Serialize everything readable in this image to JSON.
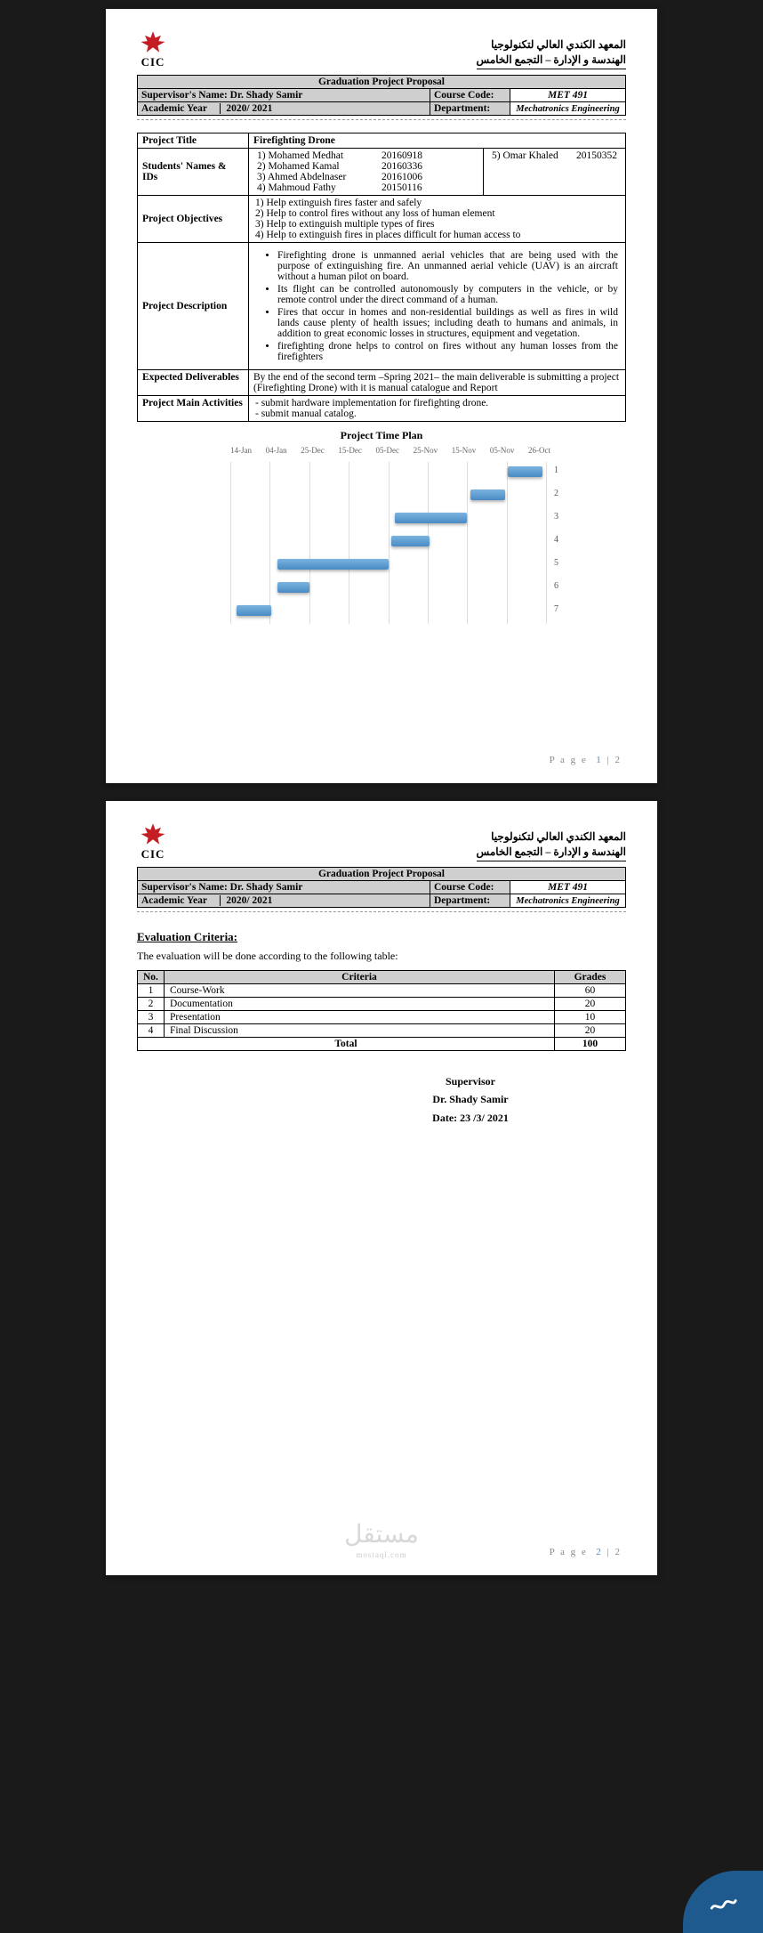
{
  "institute_name_ar_line1": "المعهد الكندي العالي لتكنولوجيا",
  "institute_name_ar_line2": "الهندسة و الإدارة – التجمع الخامس",
  "logo_text": "CIC",
  "proposal_title": "Graduation Project Proposal",
  "supervisor_label": "Supervisor's Name:",
  "supervisor_name": "Dr. Shady Samir",
  "course_code_label": "Course Code:",
  "course_code": "MET 491",
  "academic_year_label": "Academic Year",
  "academic_year": "2020/ 2021",
  "department_label": "Department:",
  "department": "Mechatronics Engineering",
  "project_title_label": "Project Title",
  "project_title": "Firefighting Drone",
  "students_label": "Students' Names & IDs",
  "students_col1": {
    "s1": "1) Mohamed Medhat",
    "s2": "2) Mohamed Kamal",
    "s3": "3) Ahmed Abdelnaser",
    "s4": "4) Mahmoud Fathy"
  },
  "students_ids1": {
    "i1": "20160918",
    "i2": "20160336",
    "i3": "20161006",
    "i4": "20150116"
  },
  "students_col2_name": "5) Omar Khaled",
  "students_col2_id": "20150352",
  "objectives_label": "Project Objectives",
  "objectives": {
    "o1": "1) Help extinguish fires faster and safely",
    "o2": "2) Help to control fires without any loss of human element",
    "o3": "3) Help to extinguish multiple types of fires",
    "o4": "4) Help to extinguish fires in places difficult for human access to"
  },
  "description_label": "Project Description",
  "description": {
    "d1": "Firefighting drone is unmanned aerial vehicles that are being used with the purpose of extinguishing fire. An unmanned aerial vehicle (UAV) is an aircraft without a human pilot on board.",
    "d2": "Its flight can be controlled autonomously by computers in the vehicle, or by remote control under the direct command of a human.",
    "d3": "Fires that occur in homes and non-residential buildings as well as fires in wild lands cause plenty of health issues; including death to humans and animals, in addition to great economic losses in structures, equipment and vegetation.",
    "d4": "firefighting drone helps to control on fires without any human losses from the firefighters"
  },
  "deliverables_label": "Expected Deliverables",
  "deliverables": "By the end of the second term –Spring 2021– the main deliverable is submitting a project (Firefighting Drone) with it is manual catalogue and Report",
  "activities_label": "Project Main Activities",
  "activities": {
    "a1": "-    submit hardware implementation for firefighting drone.",
    "a2": "-    submit manual catalog."
  },
  "timeplan_title": "Project Time Plan",
  "chart_data": {
    "type": "bar",
    "orientation": "horizontal",
    "x_reversed": true,
    "categories": [
      "14-Jan",
      "04-Jan",
      "25-Dec",
      "15-Dec",
      "05-Dec",
      "25-Nov",
      "15-Nov",
      "05-Nov",
      "26-Oct"
    ],
    "series": [
      {
        "name": "1",
        "start": "26-Oct",
        "end": "05-Nov"
      },
      {
        "name": "2",
        "start": "05-Nov",
        "end": "15-Nov"
      },
      {
        "name": "3",
        "start": "15-Nov",
        "end": "05-Dec"
      },
      {
        "name": "4",
        "start": "25-Nov",
        "end": "05-Dec"
      },
      {
        "name": "5",
        "start": "05-Dec",
        "end": "04-Jan"
      },
      {
        "name": "6",
        "start": "25-Dec",
        "end": "04-Jan"
      },
      {
        "name": "7",
        "start": "04-Jan",
        "end": "14-Jan"
      }
    ],
    "title": "Project Time Plan"
  },
  "page1_num": "P a g e  1 | 2",
  "page2_num": "P a g e  2 | 2",
  "eval_heading": "Evaluation Criteria:",
  "eval_text": "The evaluation will be done according to the following table:",
  "eval_headers": {
    "no": "No.",
    "crit": "Criteria",
    "grade": "Grades"
  },
  "eval_rows": {
    "r1": {
      "no": "1",
      "crit": "Course-Work",
      "grade": "60"
    },
    "r2": {
      "no": "2",
      "crit": "Documentation",
      "grade": "20"
    },
    "r3": {
      "no": "3",
      "crit": "Presentation",
      "grade": "10"
    },
    "r4": {
      "no": "4",
      "crit": "Final Discussion",
      "grade": "20"
    }
  },
  "eval_total_label": "Total",
  "eval_total": "100",
  "sig_title": "Supervisor",
  "sig_name": "Dr. Shady Samir",
  "sig_date": "Date:  23 /3/ 2021",
  "watermark": "مستقل",
  "watermark_sub": "mostaql.com"
}
